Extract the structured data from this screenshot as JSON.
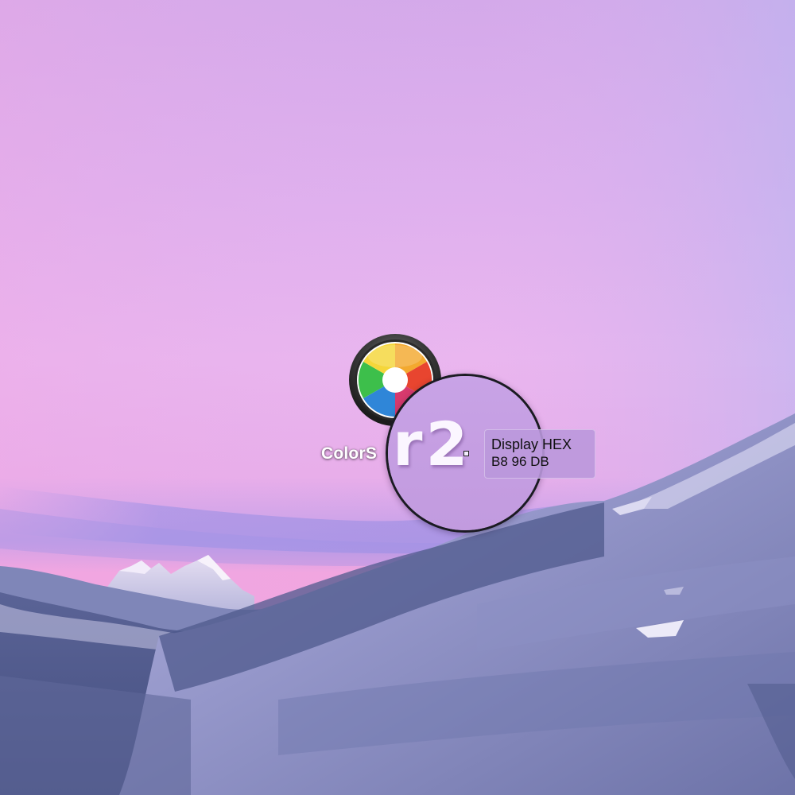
{
  "desktop": {
    "wallpaper": {
      "sky_colors": [
        "#d6a8ea",
        "#e7b6ef",
        "#f0b8ef",
        "#b9aaf0",
        "#f2a5e2"
      ],
      "mountain_colors": [
        "#7c7fb8",
        "#9fa3d2",
        "#d7d6ef",
        "#4f5a8a"
      ]
    },
    "app_icon": {
      "icon": "colorsnapper-aperture-icon",
      "label": "ColorS"
    }
  },
  "magnifier": {
    "zoomed_text": "r2",
    "border_color": "#1b1b22",
    "fill_color": "#c8a2e4"
  },
  "tooltip": {
    "title": "Display HEX",
    "value": "B8 96 DB",
    "color": "#B896DB"
  }
}
